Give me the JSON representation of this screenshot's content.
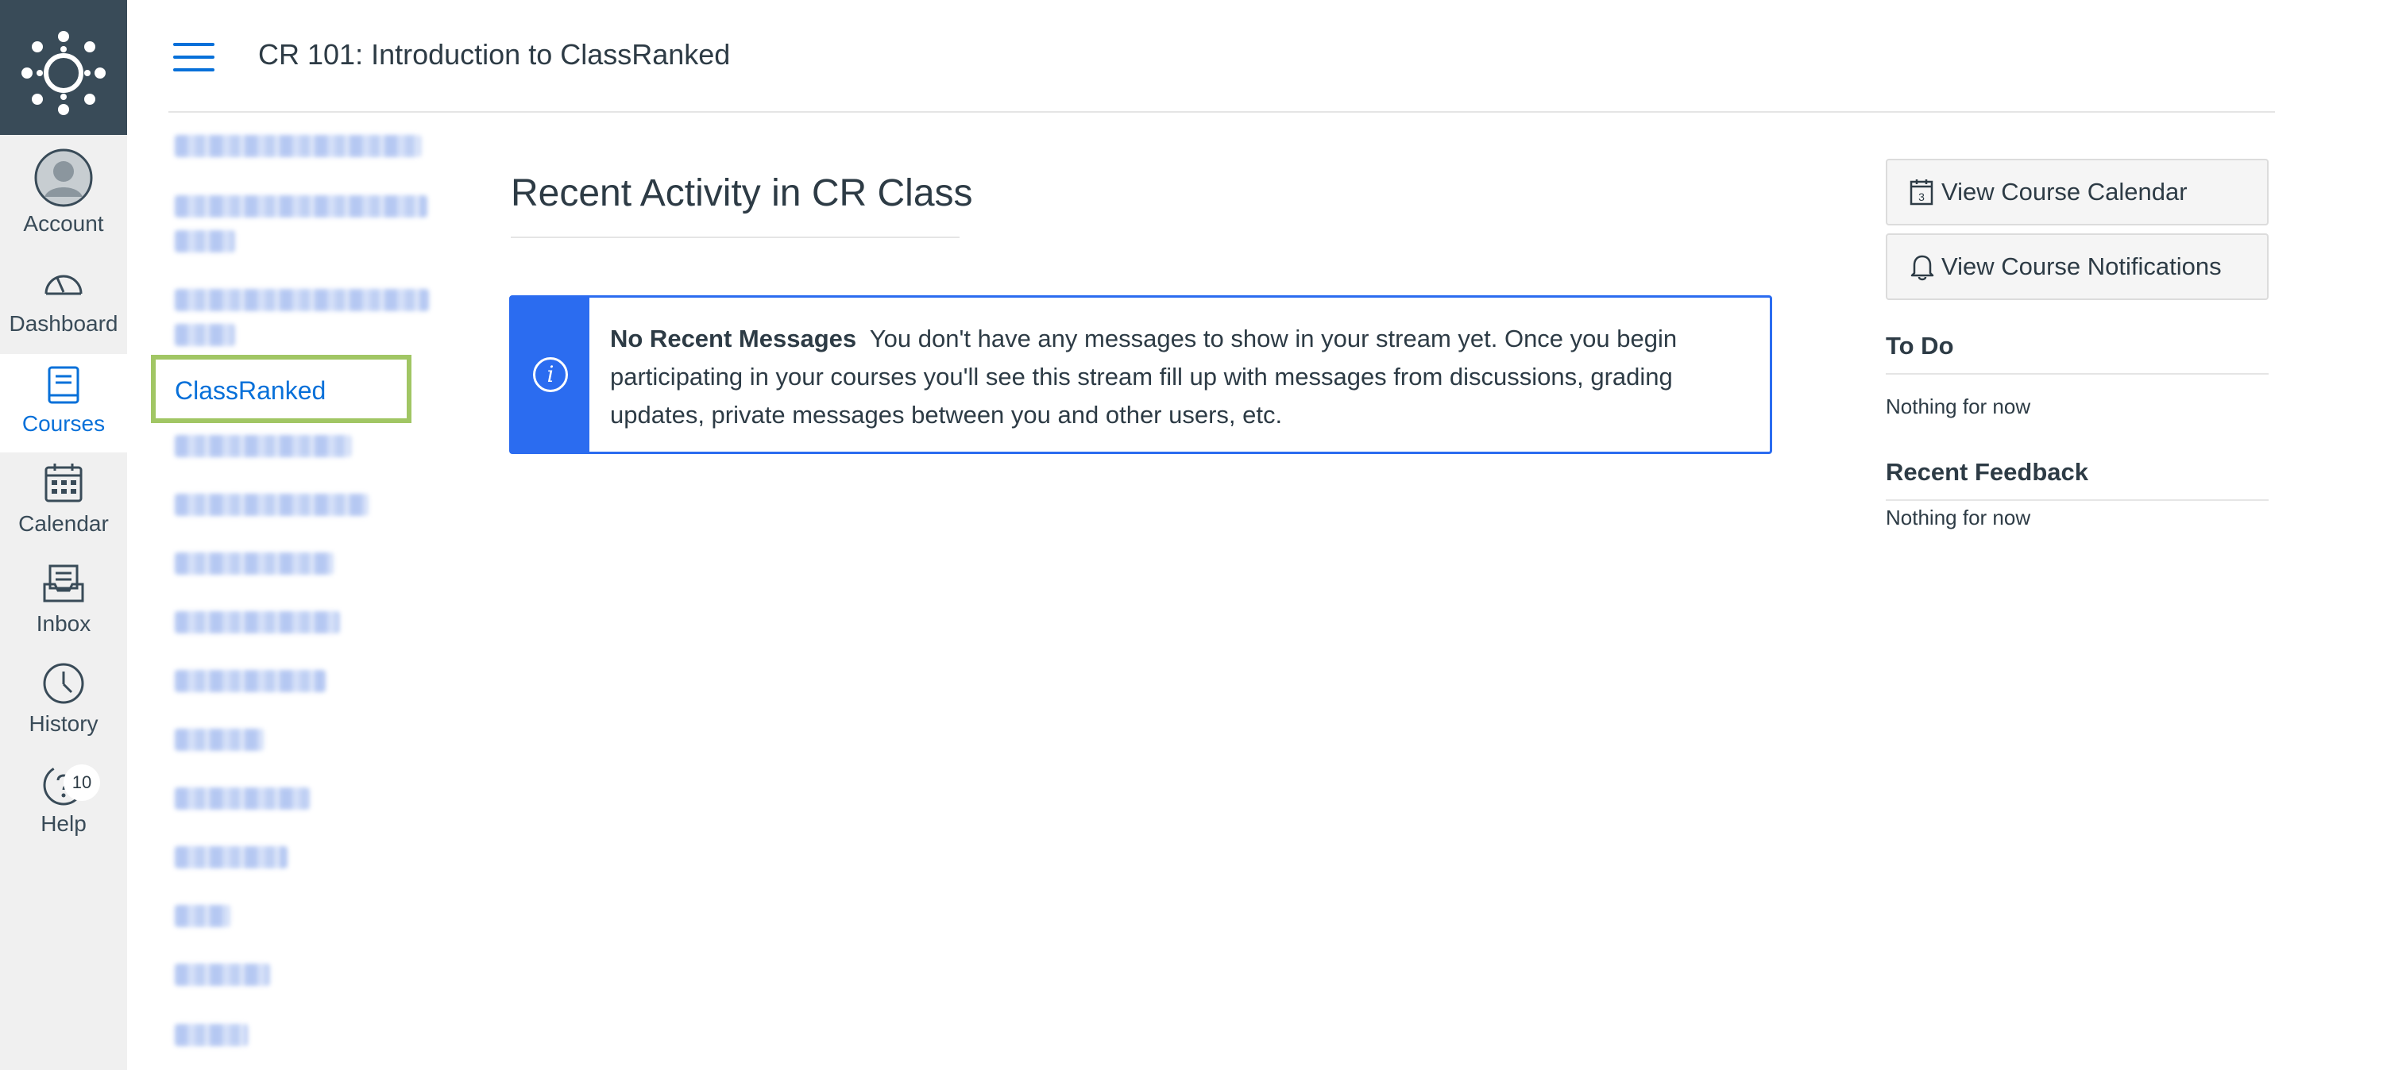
{
  "global_nav": {
    "logo": "canvas-logo-icon",
    "items": [
      {
        "label": "Account",
        "icon": "avatar-icon"
      },
      {
        "label": "Dashboard",
        "icon": "dashboard-icon"
      },
      {
        "label": "Courses",
        "icon": "courses-icon",
        "active": true
      },
      {
        "label": "Calendar",
        "icon": "calendar-icon"
      },
      {
        "label": "Inbox",
        "icon": "inbox-icon"
      },
      {
        "label": "History",
        "icon": "history-icon"
      },
      {
        "label": "Help",
        "icon": "help-icon",
        "badge": "10"
      }
    ]
  },
  "header": {
    "menu_icon": "hamburger-icon",
    "breadcrumb": "CR 101: Introduction to ClassRanked"
  },
  "course_list": {
    "active": "ClassRanked"
  },
  "main": {
    "title": "Recent Activity in CR Class",
    "alert": {
      "icon": "info-icon",
      "heading": "No Recent Messages",
      "body": "You don't have any messages to show in your stream yet. Once you begin participating in your courses you'll see this stream fill up with messages from discussions, grading updates, private messages between you and other users, etc."
    }
  },
  "sidebar": {
    "calendar_button": "View Course Calendar",
    "notifications_button": "View Course Notifications",
    "todo": {
      "title": "To Do",
      "empty": "Nothing for now"
    },
    "feedback": {
      "title": "Recent Feedback",
      "empty": "Nothing for now"
    }
  },
  "colors": {
    "nav_bg": "#f0f0f0",
    "logo_bg": "#394b58",
    "accent": "#0770d9",
    "alert_blue": "#2b6cf0",
    "highlight_green": "#a1c664"
  }
}
